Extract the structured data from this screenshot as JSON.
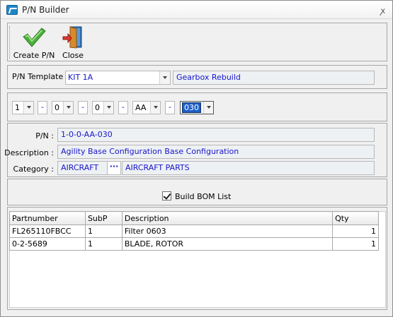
{
  "window": {
    "title": "P/N Builder",
    "close_glyph": "ꭗ"
  },
  "toolbar": {
    "create_label": "Create P/N",
    "close_label": "Close"
  },
  "template": {
    "label": "P/N Template :",
    "value": "KIT 1A",
    "description": "Gearbox Rebuild"
  },
  "segments": {
    "values": [
      "1",
      "0",
      "0",
      "AA",
      "030"
    ],
    "separator": "-"
  },
  "info": {
    "pn_label": "P/N :",
    "pn_value": "1-0-0-AA-030",
    "description_label": "Description :",
    "description_value": "Agility Base Configuration Base Configuration",
    "category_label": "Category :",
    "category_code": "AIRCRAFT",
    "category_name": "AIRCRAFT PARTS",
    "browse_glyph": "···"
  },
  "bom": {
    "checkbox_label": "Build BOM List",
    "checked": true
  },
  "grid": {
    "columns": [
      "Partnumber",
      "SubP",
      "Description",
      "Qty"
    ],
    "rows": [
      {
        "partnumber": "FL265110FBCC",
        "subp": "1",
        "description": "Filter 0603",
        "qty": "1"
      },
      {
        "partnumber": "0-2-5689",
        "subp": "1",
        "description": "BLADE, ROTOR",
        "qty": "1"
      }
    ]
  },
  "colors": {
    "value_text": "#1515c8",
    "selection": "#1d5fc8"
  },
  "icons": {
    "create": "green-checkmark-icon",
    "close": "exit-door-icon",
    "app": "pn-builder-app-icon"
  }
}
